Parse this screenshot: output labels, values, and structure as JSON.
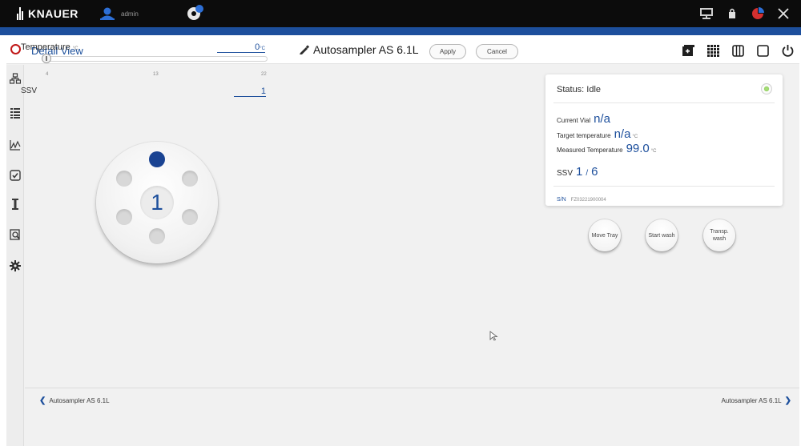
{
  "topbar": {
    "logo_text": "KNAUER",
    "user_name": "admin",
    "accent": "#1d4f9c",
    "icons": [
      "user-icon",
      "cloud-icon",
      "network-icon",
      "lock-icon",
      "dashboard-icon",
      "close-icon"
    ]
  },
  "header": {
    "page_title": "Detail View",
    "device_title": "Autosampler AS 6.1L",
    "apply_label": "Apply",
    "cancel_label": "Cancel",
    "icons": [
      "add-window-icon",
      "grid-view-icon",
      "columns-icon",
      "window-icon",
      "power-icon"
    ]
  },
  "sidebar": {
    "items": [
      "devices-icon",
      "method-list-icon",
      "chart-icon",
      "checklist-icon",
      "column-icon",
      "search-report-icon",
      "settings-icon"
    ]
  },
  "controls": {
    "temperature_label": "Temperature",
    "temperature_unit": "°C",
    "temperature_value": "0",
    "slider_min": "4",
    "slider_mid": "13",
    "slider_max": "22",
    "slider_fraction": 0.0,
    "ssv_label": "SSV",
    "ssv_value": "1"
  },
  "valve": {
    "position": "1",
    "active_port_color": "#1a4392"
  },
  "status_card": {
    "status": "Status: Idle",
    "current_vial_label": "Current Vial",
    "current_vial_value": "n/a",
    "target_temp_label": "Target temperature",
    "target_temp_value": "n/a",
    "target_temp_unit": "°C",
    "measured_temp_label": "Measured Temperature",
    "measured_temp_value": "99.0",
    "measured_temp_unit": "°C",
    "ssv_label": "SSV",
    "ssv_current": "1",
    "ssv_total": "6",
    "sn_label": "S/N",
    "sn_value": "FZ03221900004",
    "led_color": "#9bd26d"
  },
  "actions": {
    "move_tray": "Move Tray",
    "start_wash": "Start wash",
    "transp_wash": "Transp. wash"
  },
  "footer": {
    "prev_label": "Autosampler AS 6.1L",
    "next_label": "Autosampler AS 6.1L"
  }
}
